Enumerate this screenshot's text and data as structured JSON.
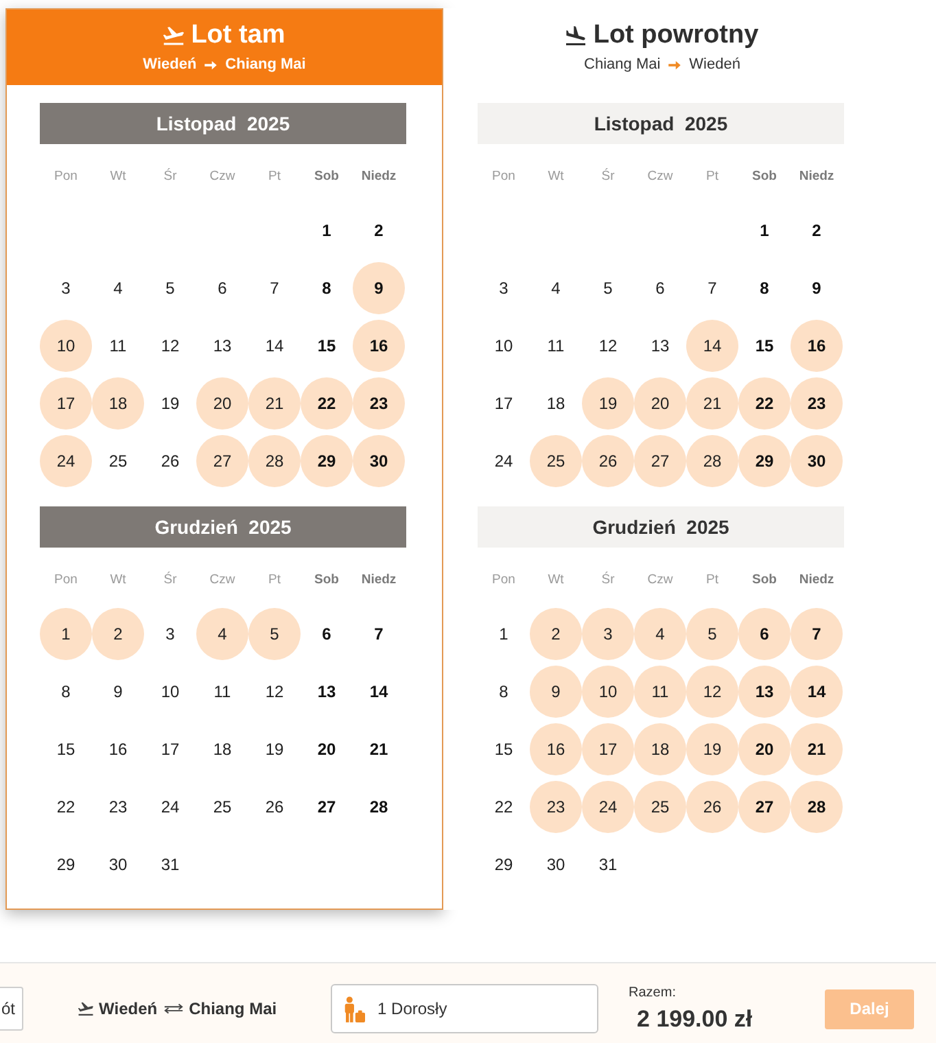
{
  "panels": [
    {
      "kind": "outbound",
      "selected": true,
      "title": "Lot tam",
      "route": {
        "from": "Wiedeń",
        "to": "Chiang Mai"
      },
      "months": [
        {
          "title": "Listopad  2025",
          "weekdays": [
            {
              "label": "Pon",
              "weekend": false
            },
            {
              "label": "Wt",
              "weekend": false
            },
            {
              "label": "Śr",
              "weekend": false
            },
            {
              "label": "Czw",
              "weekend": false
            },
            {
              "label": "Pt",
              "weekend": false
            },
            {
              "label": "Sob",
              "weekend": true
            },
            {
              "label": "Niedz",
              "weekend": true
            }
          ],
          "weeks": [
            [
              {
                "day": "1",
                "available": false
              },
              {
                "day": "2",
                "available": false
              }
            ],
            [
              {
                "day": "3",
                "available": false
              },
              {
                "day": "4",
                "available": false
              },
              {
                "day": "5",
                "available": false
              },
              {
                "day": "6",
                "available": false
              },
              {
                "day": "7",
                "available": false
              },
              {
                "day": "8",
                "available": false
              },
              {
                "day": "9",
                "available": true
              }
            ],
            [
              {
                "day": "10",
                "available": true
              },
              {
                "day": "11",
                "available": false
              },
              {
                "day": "12",
                "available": false
              },
              {
                "day": "13",
                "available": false
              },
              {
                "day": "14",
                "available": false
              },
              {
                "day": "15",
                "available": false
              },
              {
                "day": "16",
                "available": true
              }
            ],
            [
              {
                "day": "17",
                "available": true
              },
              {
                "day": "18",
                "available": true
              },
              {
                "day": "19",
                "available": false
              },
              {
                "day": "20",
                "available": true
              },
              {
                "day": "21",
                "available": true
              },
              {
                "day": "22",
                "available": true
              },
              {
                "day": "23",
                "available": true
              }
            ],
            [
              {
                "day": "24",
                "available": true
              },
              {
                "day": "25",
                "available": false
              },
              {
                "day": "26",
                "available": false
              },
              {
                "day": "27",
                "available": true
              },
              {
                "day": "28",
                "available": true
              },
              {
                "day": "29",
                "available": true
              },
              {
                "day": "30",
                "available": true
              }
            ]
          ]
        },
        {
          "title": "Grudzień  2025",
          "weekdays": [
            {
              "label": "Pon",
              "weekend": false
            },
            {
              "label": "Wt",
              "weekend": false
            },
            {
              "label": "Śr",
              "weekend": false
            },
            {
              "label": "Czw",
              "weekend": false
            },
            {
              "label": "Pt",
              "weekend": false
            },
            {
              "label": "Sob",
              "weekend": true
            },
            {
              "label": "Niedz",
              "weekend": true
            }
          ],
          "weeks": [
            [
              {
                "day": "1",
                "available": true
              },
              {
                "day": "2",
                "available": true
              },
              {
                "day": "3",
                "available": false
              },
              {
                "day": "4",
                "available": true
              },
              {
                "day": "5",
                "available": true
              },
              {
                "day": "6",
                "available": false
              },
              {
                "day": "7",
                "available": false
              }
            ],
            [
              {
                "day": "8",
                "available": false
              },
              {
                "day": "9",
                "available": false
              },
              {
                "day": "10",
                "available": false
              },
              {
                "day": "11",
                "available": false
              },
              {
                "day": "12",
                "available": false
              },
              {
                "day": "13",
                "available": false
              },
              {
                "day": "14",
                "available": false
              }
            ],
            [
              {
                "day": "15",
                "available": false
              },
              {
                "day": "16",
                "available": false
              },
              {
                "day": "17",
                "available": false
              },
              {
                "day": "18",
                "available": false
              },
              {
                "day": "19",
                "available": false
              },
              {
                "day": "20",
                "available": false
              },
              {
                "day": "21",
                "available": false
              }
            ],
            [
              {
                "day": "22",
                "available": false
              },
              {
                "day": "23",
                "available": false
              },
              {
                "day": "24",
                "available": false
              },
              {
                "day": "25",
                "available": false
              },
              {
                "day": "26",
                "available": false
              },
              {
                "day": "27",
                "available": false
              },
              {
                "day": "28",
                "available": false
              }
            ],
            [
              {
                "day": "29",
                "available": false
              },
              {
                "day": "30",
                "available": false
              },
              {
                "day": "31",
                "available": false
              }
            ]
          ]
        }
      ]
    },
    {
      "kind": "return",
      "selected": false,
      "title": "Lot powrotny",
      "route": {
        "from": "Chiang Mai",
        "to": "Wiedeń"
      },
      "months": [
        {
          "title": "Listopad  2025",
          "weekdays": [
            {
              "label": "Pon",
              "weekend": false
            },
            {
              "label": "Wt",
              "weekend": false
            },
            {
              "label": "Śr",
              "weekend": false
            },
            {
              "label": "Czw",
              "weekend": false
            },
            {
              "label": "Pt",
              "weekend": false
            },
            {
              "label": "Sob",
              "weekend": true
            },
            {
              "label": "Niedz",
              "weekend": true
            }
          ],
          "weeks": [
            [
              {
                "day": "1",
                "available": false
              },
              {
                "day": "2",
                "available": false
              }
            ],
            [
              {
                "day": "3",
                "available": false
              },
              {
                "day": "4",
                "available": false
              },
              {
                "day": "5",
                "available": false
              },
              {
                "day": "6",
                "available": false
              },
              {
                "day": "7",
                "available": false
              },
              {
                "day": "8",
                "available": false
              },
              {
                "day": "9",
                "available": false
              }
            ],
            [
              {
                "day": "10",
                "available": false
              },
              {
                "day": "11",
                "available": false
              },
              {
                "day": "12",
                "available": false
              },
              {
                "day": "13",
                "available": false
              },
              {
                "day": "14",
                "available": true
              },
              {
                "day": "15",
                "available": false
              },
              {
                "day": "16",
                "available": true
              }
            ],
            [
              {
                "day": "17",
                "available": false
              },
              {
                "day": "18",
                "available": false
              },
              {
                "day": "19",
                "available": true
              },
              {
                "day": "20",
                "available": true
              },
              {
                "day": "21",
                "available": true
              },
              {
                "day": "22",
                "available": true
              },
              {
                "day": "23",
                "available": true
              }
            ],
            [
              {
                "day": "24",
                "available": false
              },
              {
                "day": "25",
                "available": true
              },
              {
                "day": "26",
                "available": true
              },
              {
                "day": "27",
                "available": true
              },
              {
                "day": "28",
                "available": true
              },
              {
                "day": "29",
                "available": true
              },
              {
                "day": "30",
                "available": true
              }
            ]
          ]
        },
        {
          "title": "Grudzień  2025",
          "weekdays": [
            {
              "label": "Pon",
              "weekend": false
            },
            {
              "label": "Wt",
              "weekend": false
            },
            {
              "label": "Śr",
              "weekend": false
            },
            {
              "label": "Czw",
              "weekend": false
            },
            {
              "label": "Pt",
              "weekend": false
            },
            {
              "label": "Sob",
              "weekend": true
            },
            {
              "label": "Niedz",
              "weekend": true
            }
          ],
          "weeks": [
            [
              {
                "day": "1",
                "available": false
              },
              {
                "day": "2",
                "available": true
              },
              {
                "day": "3",
                "available": true
              },
              {
                "day": "4",
                "available": true
              },
              {
                "day": "5",
                "available": true
              },
              {
                "day": "6",
                "available": true
              },
              {
                "day": "7",
                "available": true
              }
            ],
            [
              {
                "day": "8",
                "available": false
              },
              {
                "day": "9",
                "available": true
              },
              {
                "day": "10",
                "available": true
              },
              {
                "day": "11",
                "available": true
              },
              {
                "day": "12",
                "available": true
              },
              {
                "day": "13",
                "available": true
              },
              {
                "day": "14",
                "available": true
              }
            ],
            [
              {
                "day": "15",
                "available": false
              },
              {
                "day": "16",
                "available": true
              },
              {
                "day": "17",
                "available": true
              },
              {
                "day": "18",
                "available": true
              },
              {
                "day": "19",
                "available": true
              },
              {
                "day": "20",
                "available": true
              },
              {
                "day": "21",
                "available": true
              }
            ],
            [
              {
                "day": "22",
                "available": false
              },
              {
                "day": "23",
                "available": true
              },
              {
                "day": "24",
                "available": true
              },
              {
                "day": "25",
                "available": true
              },
              {
                "day": "26",
                "available": true
              },
              {
                "day": "27",
                "available": true
              },
              {
                "day": "28",
                "available": true
              }
            ],
            [
              {
                "day": "29",
                "available": false
              },
              {
                "day": "30",
                "available": false
              },
              {
                "day": "31",
                "available": false
              }
            ]
          ]
        }
      ]
    }
  ],
  "booking_bar": {
    "back_button": {
      "label": "ót"
    },
    "route": {
      "from": "Wiedeń",
      "to": "Chiang Mai"
    },
    "passengers": {
      "value": "1 Dorosły"
    },
    "total_label": "Razem:",
    "total": "2 199.00 zł",
    "next_button": {
      "label": "Dalej",
      "disabled": true
    }
  }
}
